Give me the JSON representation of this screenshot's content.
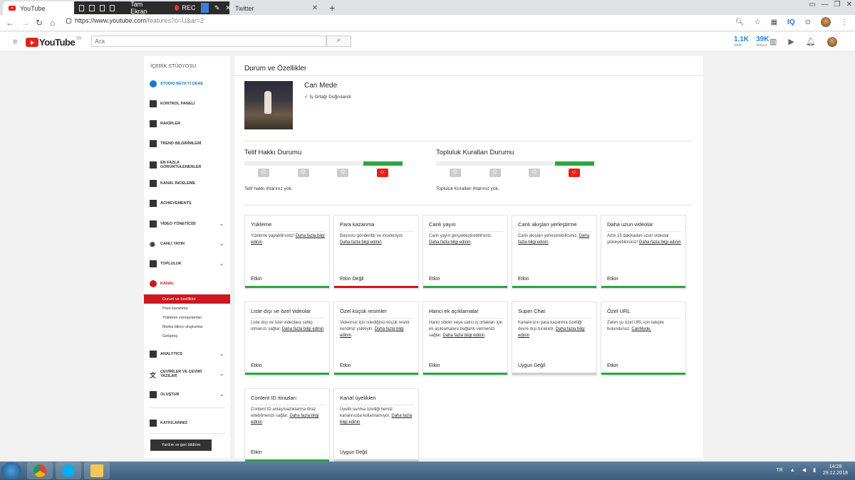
{
  "browser": {
    "tabs": [
      {
        "title": "YouTube"
      },
      {
        "title": "Twitter"
      }
    ],
    "recorder": {
      "fullscreen_label": "Tam Ekran",
      "rec_label": "REC"
    },
    "url": {
      "host": "https://www.youtube.com",
      "path": "/features?o=U&ar=2"
    },
    "iq_label": "IQ"
  },
  "youtube_header": {
    "logo_text": "YouTube",
    "logo_region": "TR",
    "search_placeholder": "Ara",
    "stats": [
      {
        "value": "1.1K",
        "label": "dödk"
      },
      {
        "value": "39K",
        "label": "dödast"
      }
    ]
  },
  "sidebar": {
    "heading": "İÇERİK STÜDYOSU",
    "items": [
      {
        "label": "STUDIO BETA'YI DENE"
      },
      {
        "label": "KONTROL PANELİ"
      },
      {
        "label": "RAKİPLER"
      },
      {
        "label": "TREND BİLDİRİMLERİ"
      },
      {
        "label": "EN FAZLA GÖRÜNTÜLENENLER"
      },
      {
        "label": "KANAL İNCELEME"
      },
      {
        "label": "ACHIEVEMENTS"
      },
      {
        "label": "VİDEO YÖNETİCİSİ"
      },
      {
        "label": "CANLI YAYIN"
      },
      {
        "label": "TOPLULUK"
      },
      {
        "label": "KANAL"
      },
      {
        "label": "ANALYTICS"
      },
      {
        "label": "ÇEVİRİLER VE ÇEVİRİ YAZILAR"
      },
      {
        "label": "OLUŞTUR"
      },
      {
        "label": "KATKILARINIZ"
      }
    ],
    "kanal_sub": [
      {
        "label": "Durum ve özellikler"
      },
      {
        "label": "Para kazanma"
      },
      {
        "label": "Yükleme varsayılanları"
      },
      {
        "label": "Marka bilinci oluşturma"
      },
      {
        "label": "Gelişmiş"
      }
    ],
    "help_button": "Yardım ve geri bildirim"
  },
  "main": {
    "title": "Durum ve Özellikler",
    "channel_name": "Can Mede",
    "verified_label": "İş Ortağı Doğrulandı",
    "copyright": {
      "title": "Telif Hakkı Durumu",
      "note": "Telif hakkı ihtarınız yok.",
      "level": 4
    },
    "community": {
      "title": "Topluluk Kuralları Durumu",
      "note": "Topluluk Kuralları ihtarınız yok.",
      "level": 4
    },
    "features": [
      {
        "title": "Yükleme",
        "desc": "Yükleme yapabilirsiniz!",
        "link": "Daha fazla bilgi edinin",
        "status": "Etkin",
        "state": "ok"
      },
      {
        "title": "Para kazanma",
        "desc": "Başvuru gönderildi ve inceleniyor.",
        "link": "Daha fazla bilgi edinin",
        "status": "Etkin Değil",
        "state": "off"
      },
      {
        "title": "Canlı yayın",
        "desc": "Canlı yayın gerçekleştirebilirsiniz.",
        "link": "Daha fazla bilgi edinin",
        "status": "Etkin",
        "state": "ok"
      },
      {
        "title": "Canlı akışları yerleştirme",
        "desc": "Canlı akışları yerleştirebilirsiniz.",
        "link": "Daha fazla bilgi edinin",
        "status": "Etkin",
        "state": "ok"
      },
      {
        "title": "Daha uzun videolar",
        "desc": "Artık 15 dakikadan uzun videolar yükleyebilirsiniz!",
        "link": "Daha fazla bilgi edinin",
        "status": "Etkin",
        "state": "ok"
      },
      {
        "title": "Liste dışı ve özel videolar",
        "desc": "Liste dışı ve özel videolara sahip olmanızı sağlar.",
        "link": "Daha fazla bilgi edinin",
        "status": "Etkin",
        "state": "ok"
      },
      {
        "title": "Özel küçük resimler",
        "desc": "Videonuz için istediğiniz küçük resmi kendiniz yükleyin.",
        "link": "Daha fazla bilgi edinin",
        "status": "Etkin",
        "state": "ok"
      },
      {
        "title": "Harici ek açıklamalar",
        "desc": "Harici siteler veya satıcı iş ortakları için ek açıklamalara bağlantı vermenizi sağlar.",
        "link": "Daha fazla bilgi edinin",
        "status": "Etkin",
        "state": "ok"
      },
      {
        "title": "Super Chat",
        "desc": "Kanalınızın para kazanma özelliği devre dışı bırakıldı.",
        "link": "Daha fazla bilgi edinin",
        "status": "Uygun Değil",
        "state": "na"
      },
      {
        "title": "Özel URL",
        "desc": "Zaten şu özel URL için talepte bulundunuz:",
        "link": "CanMede.",
        "status": "Etkin",
        "state": "ok"
      },
      {
        "title": "Content ID itirazları",
        "desc": "Content ID anlaşmazlıklarına itiraz edebilmenizi sağlar.",
        "link": "Daha fazla bilgi edinin",
        "status": "Etkin",
        "state": "ok"
      },
      {
        "title": "Kanal üyelikleri",
        "desc": "Üyelik sunma özelliği henüz kanalınızda kullanılamıyor.",
        "link": "Daha fazla bilgi edinin",
        "status": "Uygun Değil",
        "state": "na"
      }
    ]
  },
  "taskbar": {
    "lang": "TR",
    "time": "14:28",
    "date": "29.12.2018"
  },
  "colors": {
    "ok": "#2ba640",
    "off": "#cc181e",
    "na": "#cccccc",
    "accent": "#167ac6",
    "brand": "#e62117"
  }
}
